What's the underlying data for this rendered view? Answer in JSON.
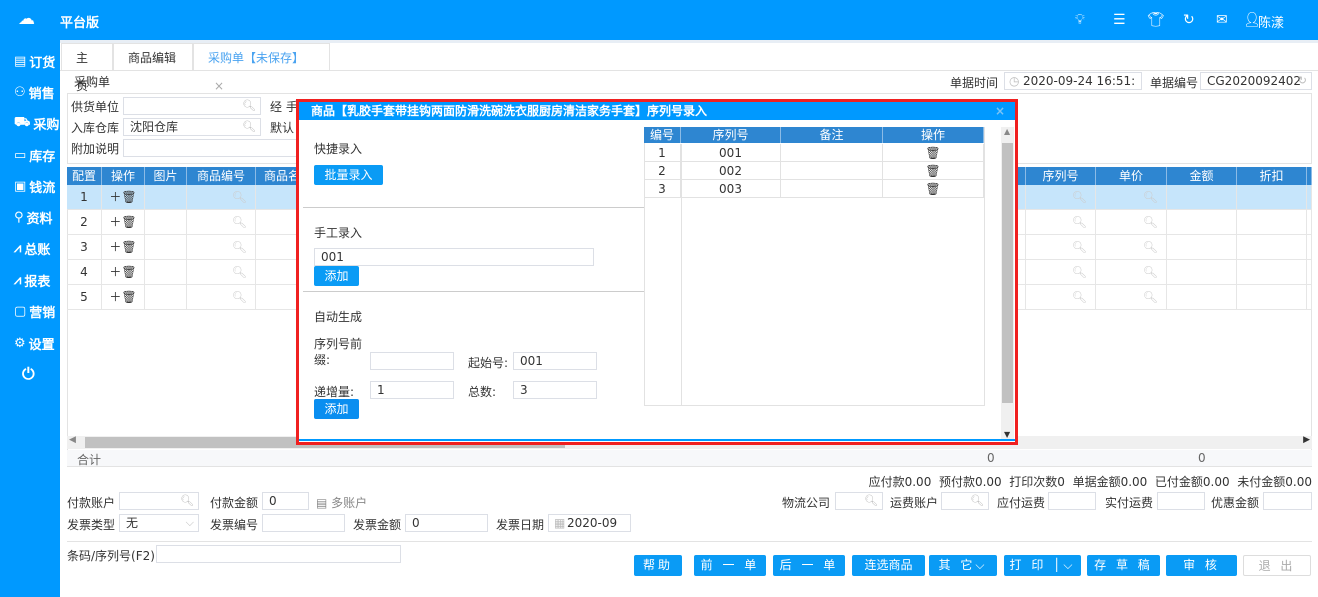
{
  "app": {
    "brand": "平台版",
    "user": "陈漾"
  },
  "top_icons": [
    "bulb-icon",
    "menu-icon",
    "shirt-icon",
    "refresh-icon",
    "mail-icon",
    "user-icon"
  ],
  "sidebar": [
    {
      "label": "订货",
      "icon": "clipboard-icon"
    },
    {
      "label": "销售",
      "icon": "person-icon"
    },
    {
      "label": "采购",
      "icon": "cart-icon"
    },
    {
      "label": "库存",
      "icon": "box-icon"
    },
    {
      "label": "钱流",
      "icon": "wallet-icon"
    },
    {
      "label": "资料",
      "icon": "contacts-icon"
    },
    {
      "label": "总账",
      "icon": "chart-icon"
    },
    {
      "label": "报表",
      "icon": "report-icon"
    },
    {
      "label": "营销",
      "icon": "monitor-icon"
    },
    {
      "label": "设置",
      "icon": "gear-icon"
    }
  ],
  "tabs": [
    {
      "label": "主页"
    },
    {
      "label": "商品编辑"
    },
    {
      "label": "采购单【未保存】"
    }
  ],
  "page_title": "采购单",
  "header": {
    "time_label": "单据时间",
    "time_value": "2020-09-24 16:51:",
    "no_label": "单据编号",
    "no_value": "CG2020092402"
  },
  "form": {
    "supplier_label": "供货单位",
    "supplier_value": "",
    "handler_label": "经 手",
    "warehouse_label": "入库仓库",
    "warehouse_value": "沈阳仓库",
    "default_label": "默认",
    "note_label": "附加说明",
    "note_value": ""
  },
  "grid": {
    "headers_left": [
      "配置",
      "操作",
      "图片",
      "商品编号",
      "商品名"
    ],
    "headers_right": [
      "序列号",
      "单价",
      "金额",
      "折扣"
    ],
    "rows": [
      "1",
      "2",
      "3",
      "4",
      "5"
    ],
    "total_label": "合计",
    "totals": [
      "0",
      "0"
    ]
  },
  "summary": "应付款0.00  预付款0.00  打印次数0  单据金额0.00  已付金额0.00  未付金额0.00",
  "payment": {
    "account_label": "付款账户",
    "amount_label": "付款金额",
    "amount_value": "0",
    "multi_label": "多账户",
    "invoice_type_label": "发票类型",
    "invoice_type_value": "无",
    "invoice_no_label": "发票编号",
    "invoice_amount_label": "发票金额",
    "invoice_amount_value": "0",
    "invoice_date_label": "发票日期",
    "invoice_date_value": "2020-09"
  },
  "logistics": {
    "company_label": "物流公司",
    "freight_account_label": "运费账户",
    "freight_due_label": "应付运费",
    "freight_paid_label": "实付运费",
    "discount_label": "优惠金额"
  },
  "barcode_label": "条码/序列号(F2)",
  "buttons": [
    "帮助",
    "前 一 单",
    "后 一 单",
    "连选商品",
    "其 它",
    "打 印",
    "存 草 稿",
    "审  核",
    "退  出"
  ],
  "dialog": {
    "title": "商品【乳胶手套带挂钩两面防滑洗碗洗衣服厨房清洁家务手套】序列号录入",
    "quick_label": "快捷录入",
    "batch_button": "批量录入",
    "manual_label": "手工录入",
    "manual_value": "001",
    "add_button": "添加",
    "auto_label": "自动生成",
    "prefix_label": "序列号前缀:",
    "prefix_value": "",
    "start_label": "起始号:",
    "start_value": "001",
    "step_label": "递增量:",
    "step_value": "1",
    "count_label": "总数:",
    "count_value": "3",
    "table_headers": [
      "编号",
      "序列号",
      "备注",
      "操作"
    ],
    "rows": [
      {
        "no": "1",
        "serial": "001",
        "note": ""
      },
      {
        "no": "2",
        "serial": "002",
        "note": ""
      },
      {
        "no": "3",
        "serial": "003",
        "note": ""
      }
    ]
  }
}
